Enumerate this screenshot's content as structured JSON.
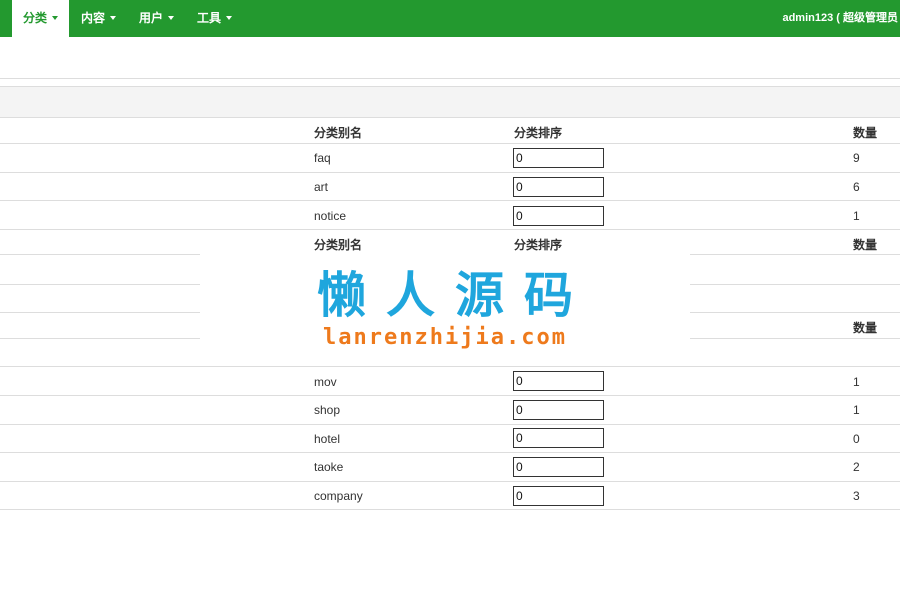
{
  "header": {
    "nav": [
      {
        "label": "分类",
        "active": true
      },
      {
        "label": "内容",
        "active": false
      },
      {
        "label": "用户",
        "active": false
      },
      {
        "label": "工具",
        "active": false
      }
    ],
    "user_label": "admin123 ( 超级管理员",
    "accent_color": "#23992f"
  },
  "table": {
    "columns": {
      "alias": "分类别名",
      "order": "分类排序",
      "count": "数量"
    },
    "group1": [
      {
        "alias": "faq",
        "order": "0",
        "count": "9"
      },
      {
        "alias": "art",
        "order": "0",
        "count": "6"
      },
      {
        "alias": "notice",
        "order": "0",
        "count": "1"
      }
    ],
    "group2_headers": {
      "alias": "分类别名",
      "order": "分类排序",
      "count": "数量"
    },
    "group3_header_count": "数量",
    "group3": [
      {
        "alias": "mov",
        "order": "0",
        "count": "1"
      },
      {
        "alias": "shop",
        "order": "0",
        "count": "1"
      },
      {
        "alias": "hotel",
        "order": "0",
        "count": "0"
      },
      {
        "alias": "taoke",
        "order": "0",
        "count": "2"
      },
      {
        "alias": "company",
        "order": "0",
        "count": "3"
      }
    ]
  },
  "watermark": {
    "title": "懒人源码",
    "url": "lanrenzhijia.com"
  }
}
